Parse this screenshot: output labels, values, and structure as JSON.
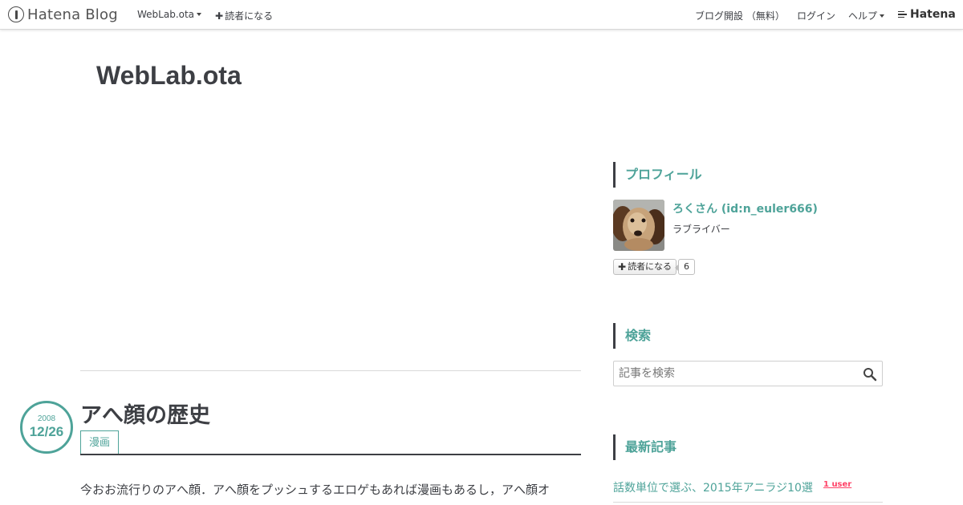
{
  "globalheader": {
    "logo_text": "Hatena Blog",
    "blog_menu_label": "WebLab.ota",
    "subscribe_label": "読者になる",
    "open_blog_label": "ブログ開設 （無料）",
    "login_label": "ログイン",
    "help_label": "ヘルプ",
    "hatena_label": "Hatena"
  },
  "blog": {
    "title": "WebLab.ota"
  },
  "entry": {
    "date_year": "2008",
    "date_md": "12/26",
    "title": "アへ顔の歴史",
    "category": "漫画",
    "body_first_line": "今おお流行りのアへ顔．アへ顔をプッシュするエロゲもあれば漫画もあるし，アへ顔オ"
  },
  "sidebar": {
    "profile": {
      "heading": "プロフィール",
      "name": "ろくさん (id:n_euler666)",
      "description": "ラブライバー",
      "subscribe_label": "読者になる",
      "subscriber_count": "6"
    },
    "search": {
      "heading": "検索",
      "placeholder": "記事を検索"
    },
    "recent": {
      "heading": "最新記事",
      "items": [
        {
          "title": "話数単位で選ぶ、2015年アニラジ10選",
          "bookmark": "1 user"
        }
      ]
    }
  },
  "colors": {
    "accent": "#4ea399",
    "text": "#3d3f44",
    "bookmark": "#ff4166"
  },
  "icons": [
    "hatena-blog-logo-icon",
    "caret-down-icon",
    "plus-icon",
    "hatena-logo-icon",
    "search-icon"
  ]
}
